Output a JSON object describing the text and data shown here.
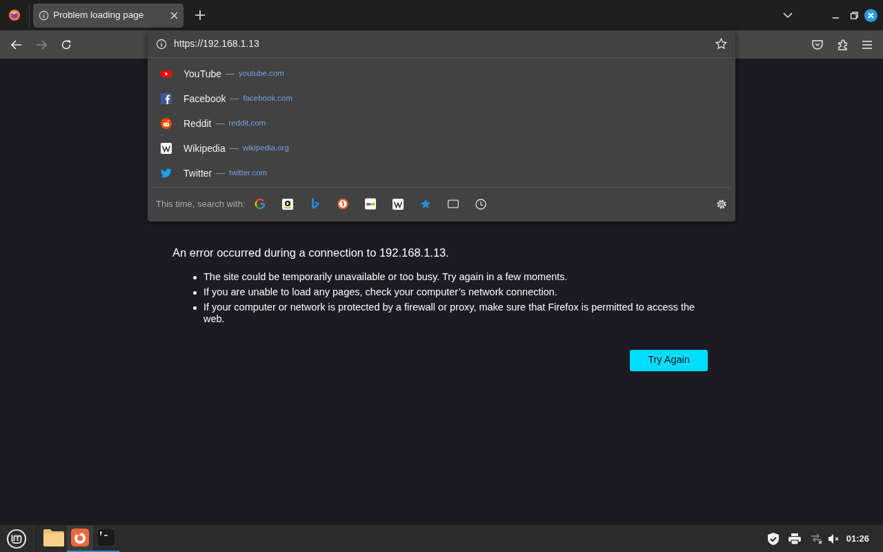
{
  "tab": {
    "title": "Problem loading page",
    "selected": true
  },
  "url": "https://192.168.1.13",
  "suggestions": [
    {
      "kind": "youtube",
      "title": "YouTube",
      "dash": "—",
      "domain": "youtube.com"
    },
    {
      "kind": "facebook",
      "title": "Facebook",
      "dash": "—",
      "domain": "facebook.com"
    },
    {
      "kind": "reddit",
      "title": "Reddit",
      "dash": "—",
      "domain": "reddit.com"
    },
    {
      "kind": "wikipedia",
      "title": "Wikipedia",
      "dash": "—",
      "domain": "wikipedia.org"
    },
    {
      "kind": "twitter",
      "title": "Twitter",
      "dash": "—",
      "domain": "twitter.com"
    }
  ],
  "search_with": {
    "label": "This time, search with:",
    "engines": [
      {
        "kind": "google"
      },
      {
        "kind": "amazon"
      },
      {
        "kind": "bing"
      },
      {
        "kind": "duckduckgo"
      },
      {
        "kind": "ebay"
      },
      {
        "kind": "wikipedia"
      },
      {
        "kind": "bookmarks"
      },
      {
        "kind": "tabs"
      },
      {
        "kind": "history"
      }
    ]
  },
  "error": {
    "message": "An error occurred during a connection to 192.168.1.13.",
    "bullets": [
      "The site could be temporarily unavailable or too busy. Try again in a few moments.",
      "If you are unable to load any pages, check your computer’s network connection.",
      "If your computer or network is protected by a firewall or proxy, make sure that Firefox is permitted to access the web."
    ],
    "button": "Try Again"
  },
  "taskbar": {
    "apps": [
      {
        "kind": "files",
        "active": false,
        "running": false
      },
      {
        "kind": "firefox",
        "active": true,
        "running": true
      },
      {
        "kind": "terminal",
        "active": false,
        "running": true
      }
    ],
    "clock": "01:26"
  }
}
